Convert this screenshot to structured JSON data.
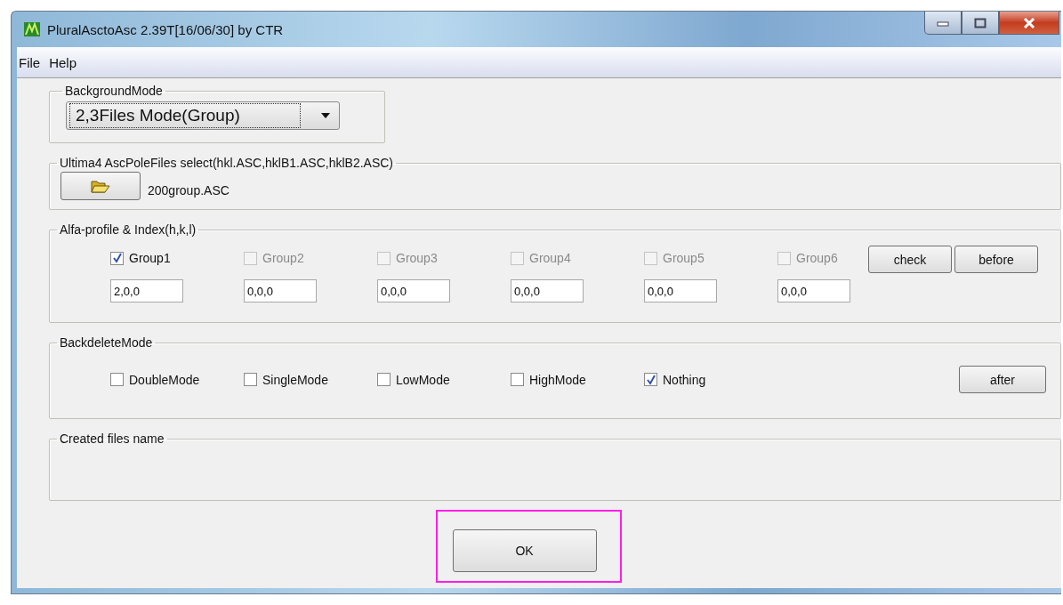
{
  "window": {
    "title": "PluralAsctoAsc 2.39T[16/06/30] by CTR"
  },
  "menu": [
    "File",
    "Help"
  ],
  "background_mode": {
    "legend": "BackgroundMode",
    "value": "2,3Files Mode(Group)"
  },
  "file_select": {
    "legend": "Ultima4 AscPoleFiles select(hkl.ASC,hklB1.ASC,hklB2.ASC)",
    "file_name": "200group.ASC"
  },
  "alfa_profile": {
    "legend": "Alfa-profile & Index(h,k,l)",
    "groups": [
      {
        "label": "Group1",
        "checked": true,
        "disabled": false,
        "value": "2,0,0"
      },
      {
        "label": "Group2",
        "checked": false,
        "disabled": true,
        "value": "0,0,0"
      },
      {
        "label": "Group3",
        "checked": false,
        "disabled": true,
        "value": "0,0,0"
      },
      {
        "label": "Group4",
        "checked": false,
        "disabled": true,
        "value": "0,0,0"
      },
      {
        "label": "Group5",
        "checked": false,
        "disabled": true,
        "value": "0,0,0"
      },
      {
        "label": "Group6",
        "checked": false,
        "disabled": true,
        "value": "0,0,0"
      }
    ],
    "buttons": [
      "check",
      "before"
    ]
  },
  "backdelete_mode": {
    "legend": "BackdeleteMode",
    "options": [
      {
        "label": "DoubleMode",
        "checked": false
      },
      {
        "label": "SingleMode",
        "checked": false
      },
      {
        "label": "LowMode",
        "checked": false
      },
      {
        "label": "HighMode",
        "checked": false
      },
      {
        "label": "Nothing",
        "checked": true
      }
    ],
    "button": "after"
  },
  "created_files": {
    "legend": "Created files name"
  },
  "ok_button": {
    "label": "OK",
    "highlighted": true
  }
}
